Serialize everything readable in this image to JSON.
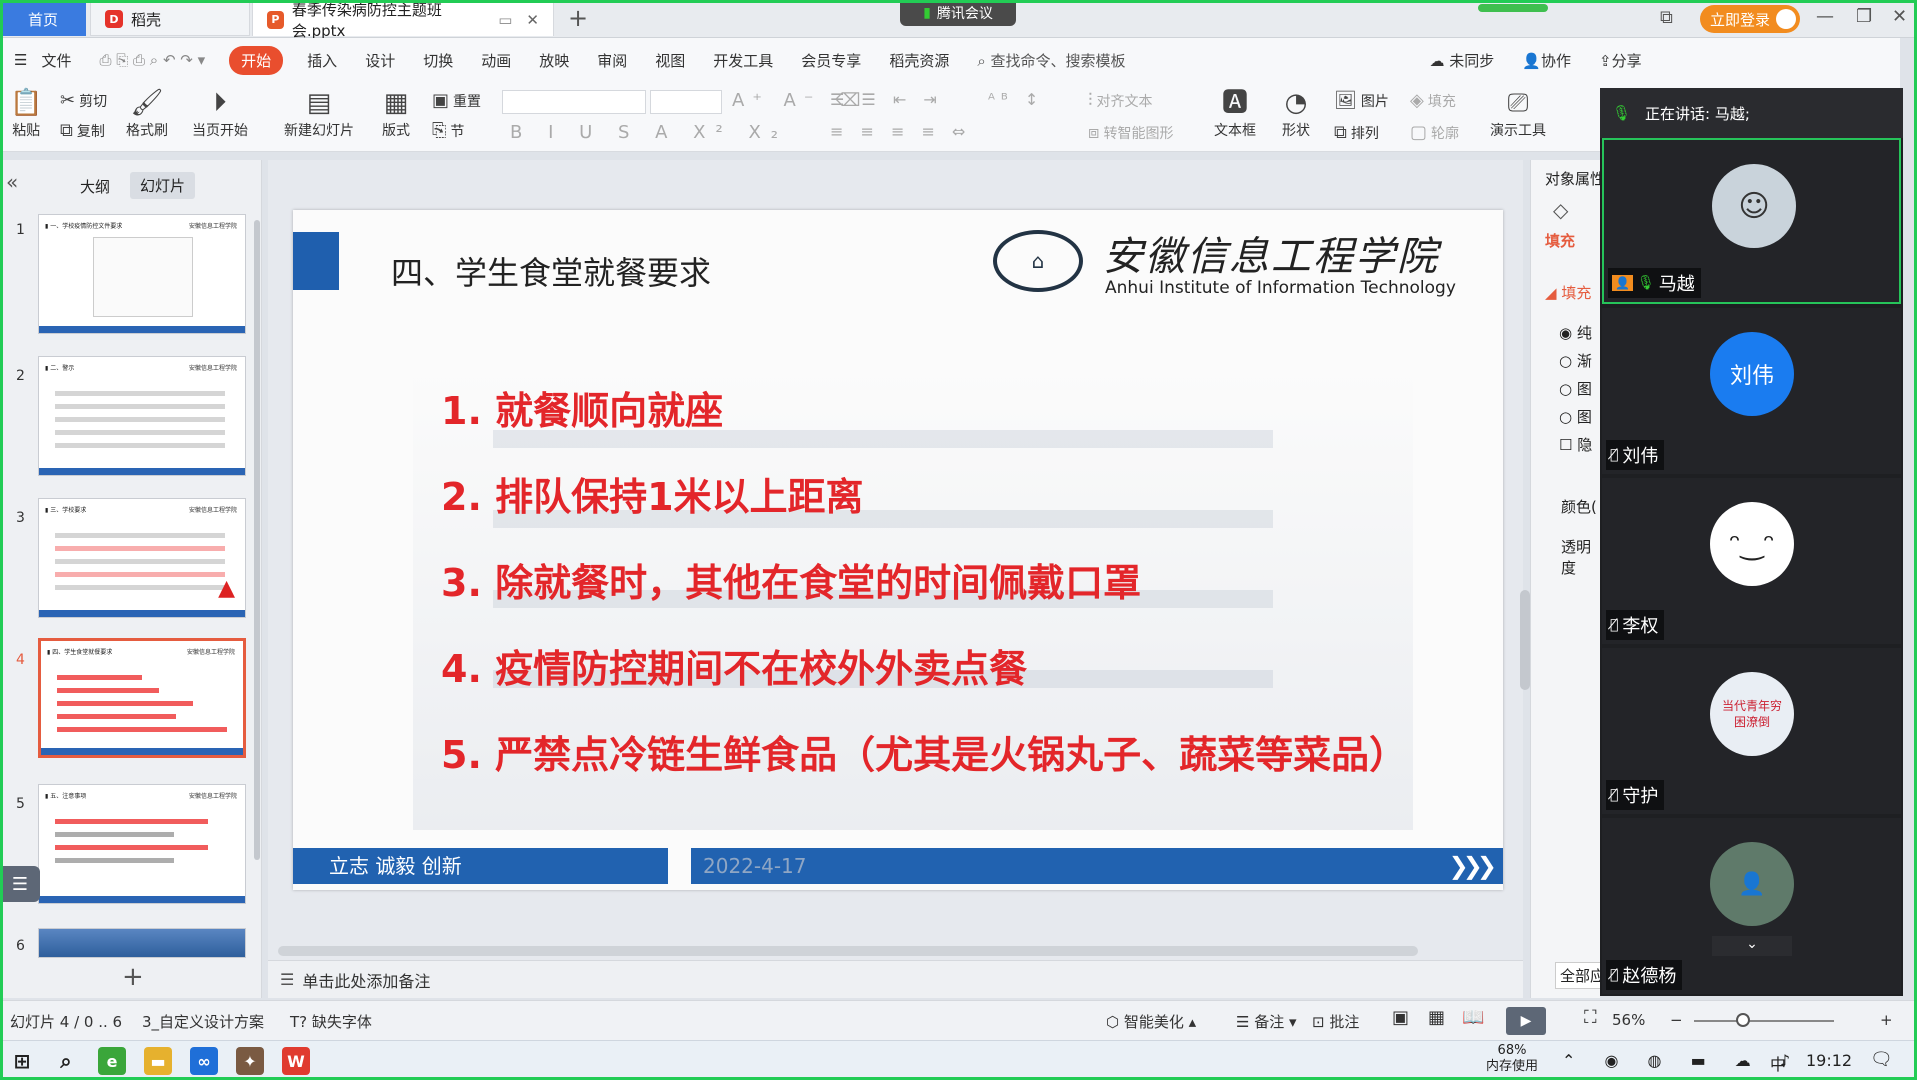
{
  "titlebar": {
    "home_tab": "首页",
    "daoke_tab": "稻壳",
    "doc_tab": "春季传染病防控主题班会.pptx",
    "new_tab": "+",
    "meeting_badge": "腾讯会议",
    "login": "立即登录"
  },
  "menu": {
    "file": "文件",
    "items": [
      "开始",
      "插入",
      "设计",
      "切换",
      "动画",
      "放映",
      "审阅",
      "视图",
      "开发工具",
      "会员专享",
      "稻壳资源"
    ],
    "search": "查找命令、搜索模板",
    "sync": "未同步",
    "collab": "协作",
    "share": "分享"
  },
  "toolbar": {
    "paste": "粘贴",
    "cut": "剪切",
    "copy": "复制",
    "format_brush": "格式刷",
    "from_current": "当页开始",
    "new_slide": "新建幻灯片",
    "layout": "版式",
    "reset": "重置",
    "section": "节",
    "align_text": "对齐文本",
    "smart_art": "转智能图形",
    "textbox": "文本框",
    "shape": "形状",
    "picture": "图片",
    "arrange": "排列",
    "fill": "填充",
    "outline": "轮廓",
    "present_tools": "演示工具"
  },
  "leftpanel": {
    "outline_tab": "大纲",
    "slides_tab": "幻灯片",
    "slide_numbers": [
      "1",
      "2",
      "3",
      "4",
      "5",
      "6"
    ],
    "add": "+"
  },
  "slide": {
    "title": "四、学生食堂就餐要求",
    "logo_cn": "安徽信息工程学院",
    "logo_en": "Anhui Institute of Information  Technology",
    "items": [
      "1. 就餐顺向就座",
      "2. 排队保持1米以上距离",
      "3. 除就餐时，其他在食堂的时间佩戴口罩",
      "4. 疫情防控期间不在校外外卖点餐",
      "5. 严禁点冷链生鲜食品（尤其是火锅丸子、蔬菜等菜品）"
    ],
    "motto": "立志  诚毅  创新",
    "date": "2022-4-17"
  },
  "notes": {
    "placeholder": "单击此处添加备注"
  },
  "proppane": {
    "title": "对象属性",
    "fill_tab": "填充",
    "fill_section": "填充",
    "options": [
      "纯",
      "渐",
      "图",
      "图",
      "隐"
    ],
    "color": "颜色(",
    "transparency": "透明度",
    "apply_all": "全部应"
  },
  "status": {
    "slide_pos": "幻灯片 4 / 0 .. 6",
    "theme": "3_自定义设计方案",
    "missing_font": "缺失字体",
    "beautify": "智能美化",
    "notes": "备注",
    "comment": "批注",
    "zoom": "56%"
  },
  "taskbar": {
    "memory_pct": "68%",
    "memory_label": "内存使用",
    "ime": "中",
    "time": "19:12"
  },
  "meeting": {
    "speaking": "正在讲话: 马越;",
    "participants": [
      {
        "name": "马越",
        "avatar": "",
        "color": "#c9d3db"
      },
      {
        "name": "刘伟",
        "avatar": "刘伟",
        "color": "#1a7cf0"
      },
      {
        "name": "李权",
        "avatar": "",
        "color": "#ffffff"
      },
      {
        "name": "守护",
        "avatar": "当代青年穷困潦倒",
        "color": "#e9eef4"
      },
      {
        "name": "赵德杨",
        "avatar": "",
        "color": "#5f7a6a"
      }
    ]
  }
}
